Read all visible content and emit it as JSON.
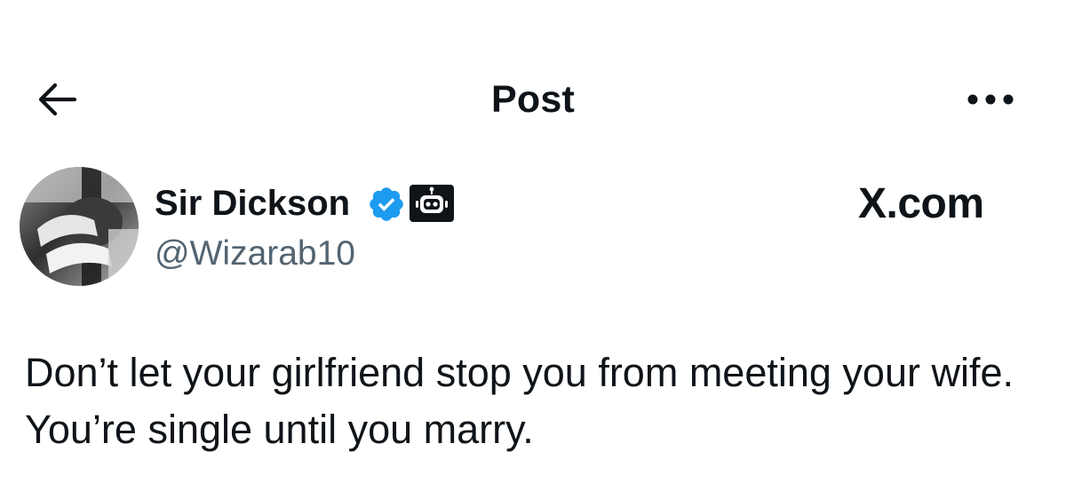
{
  "header": {
    "title": "Post",
    "back_icon": "arrow-left-icon",
    "more_icon": "more-horizontal-icon"
  },
  "author": {
    "name": "Sir Dickson",
    "handle": "@Wizarab10",
    "verified_icon": "verified-badge-icon",
    "verified_color": "#1d9bf0",
    "bot_icon": "bot-label-icon"
  },
  "site_label": "X.com",
  "post": {
    "text": "Don’t let your girlfriend stop you from meeting your wife. You’re single until you marry."
  },
  "colors": {
    "text": "#0f1419",
    "secondary_text": "#536471",
    "background": "#ffffff"
  }
}
